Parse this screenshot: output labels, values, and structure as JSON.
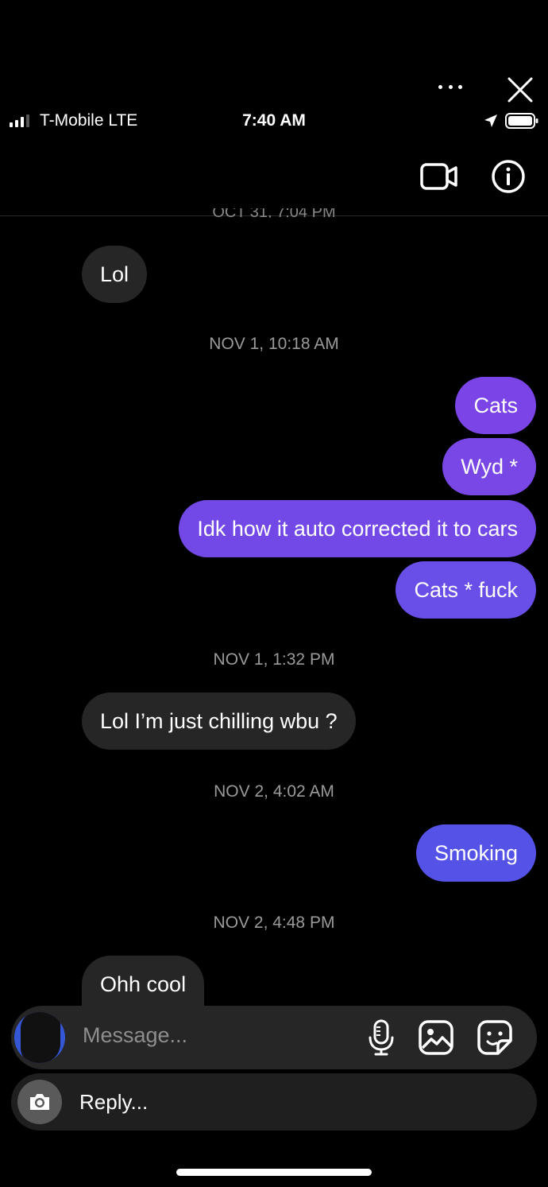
{
  "overlay": {
    "more_icon": "more-horizontal-icon",
    "close_icon": "close-icon"
  },
  "status_bar": {
    "carrier": "T-Mobile  LTE",
    "time": "7:40 AM",
    "signal_bars": 4,
    "signal_bars_filled": 3
  },
  "header": {
    "video_icon": "video-call-icon",
    "info_icon": "info-icon"
  },
  "partial_timestamp": "OCT 31, 7:04 PM",
  "messages": [
    {
      "side": "in",
      "text": "Lol"
    },
    {
      "timestamp": "NOV 1, 10:18 AM"
    },
    {
      "side": "out",
      "text": "Cats"
    },
    {
      "side": "out",
      "text": "Wyd *"
    },
    {
      "side": "out",
      "text": "Idk how it auto corrected it to cars"
    },
    {
      "side": "out",
      "text": "Cats * fuck"
    },
    {
      "timestamp": "NOV 1, 1:32 PM"
    },
    {
      "side": "in",
      "text": "Lol I’m just chilling wbu ?"
    },
    {
      "timestamp": "NOV 2, 4:02 AM"
    },
    {
      "side": "out",
      "text": "Smoking"
    },
    {
      "timestamp": "NOV 2, 4:48 PM"
    },
    {
      "side": "in",
      "text": "Ohh cool"
    }
  ],
  "composer": {
    "placeholder": "Message...",
    "mic_icon": "microphone-icon",
    "gallery_icon": "gallery-icon",
    "sticker_icon": "sticker-icon"
  },
  "reply_bar": {
    "label": "Reply...",
    "camera_icon": "camera-icon"
  },
  "colors": {
    "background": "#000000",
    "incoming_bubble": "#262626",
    "outgoing_purple": "#7a44e6",
    "outgoing_violet": "#6a4ee8",
    "outgoing_blue": "#5552e8",
    "timestamp_text": "#9a9a9a"
  }
}
